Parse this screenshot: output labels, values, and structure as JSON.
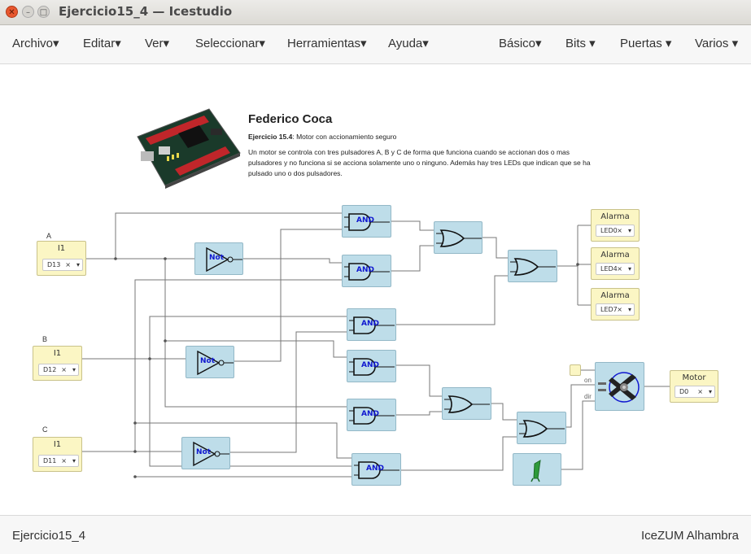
{
  "window": {
    "title": "Ejercicio15_4 — Icestudio"
  },
  "menu": {
    "left": [
      "Archivo",
      "Editar",
      "Ver",
      "Seleccionar",
      "Herramientas",
      "Ayuda"
    ],
    "right": [
      "Básico",
      "Bits",
      "Puertas",
      "Varios"
    ]
  },
  "info": {
    "author": "Federico Coca",
    "subtitle_bold": "Ejercicio 15.4",
    "subtitle_rest": ": Motor con accionamiento seguro",
    "description": "Un motor se controla con tres pulsadores A, B y C de forma que funciona cuando se accionan dos o mas pulsadores y no funciona si se acciona solamente uno o ninguno. Además hay tres LEDs que indican que se ha pulsado uno o dos pulsadores."
  },
  "inputs": [
    {
      "label": "A",
      "name": "I1",
      "pin": "D13"
    },
    {
      "label": "B",
      "name": "I1",
      "pin": "D12"
    },
    {
      "label": "C",
      "name": "I1",
      "pin": "D11"
    }
  ],
  "outputs": [
    {
      "name": "Alarma",
      "pin": "LED0"
    },
    {
      "name": "Alarma",
      "pin": "LED4"
    },
    {
      "name": "Alarma",
      "pin": "LED7"
    },
    {
      "name": "Motor",
      "pin": "D0"
    }
  ],
  "gates": {
    "and": "AND",
    "not": "Not"
  },
  "motor_driver": {
    "on_label": "on",
    "dir_label": "dir"
  },
  "icons": [
    "close-icon",
    "minimize-icon",
    "maximize-icon",
    "dropdown-caret-icon",
    "fpga-board-image",
    "motor-driver-icon",
    "constant-one-icon"
  ],
  "footer": {
    "left": "Ejercicio15_4",
    "right": "IceZUM Alhambra"
  }
}
